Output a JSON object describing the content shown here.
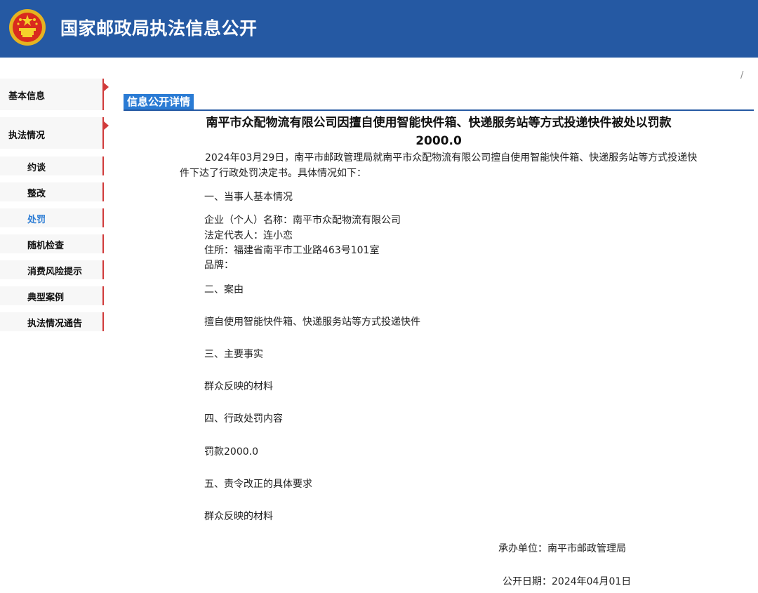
{
  "header": {
    "title": "国家邮政局执法信息公开",
    "emblem_icon": "national-emblem-icon",
    "background": "#2559a3"
  },
  "sidebar": {
    "top_items": [
      {
        "label": "基本信息"
      },
      {
        "label": "执法情况"
      }
    ],
    "sub_items": [
      {
        "label": "约谈"
      },
      {
        "label": "整改"
      },
      {
        "label": "处罚",
        "active": true
      },
      {
        "label": "随机检查"
      },
      {
        "label": "消费风险提示"
      },
      {
        "label": "典型案例"
      },
      {
        "label": "执法情况通告"
      }
    ],
    "accent": "#d13a3a",
    "active_color": "#2a7bd4"
  },
  "breadcrumb": {
    "separator": "/"
  },
  "main": {
    "section_tab": "信息公开详情",
    "title_line1": "南平市众配物流有限公司因擅自使用智能快件箱、快递服务站等方式投递快件被处以罚款",
    "title_line2": "2000.0",
    "intro": "2024年03月29日，南平市邮政管理局就南平市众配物流有限公司擅自使用智能快件箱、快递服务站等方式投递快件下达了行政处罚决定书。具体情况如下：",
    "s1_heading": "一、当事人基本情况",
    "s1_name": "企业（个人）名称：南平市众配物流有限公司",
    "s1_rep": "法定代表人：连小恋",
    "s1_addr": "住所：福建省南平市工业路463号101室",
    "s1_brand": "品牌：",
    "s2_heading": "二、案由",
    "s2_text": "擅自使用智能快件箱、快递服务站等方式投递快件",
    "s3_heading": "三、主要事实",
    "s3_text": "群众反映的材料",
    "s4_heading": "四、行政处罚内容",
    "s4_text": "罚款2000.0",
    "s5_heading": "五、责令改正的具体要求",
    "s5_text": "群众反映的材料",
    "handler": "承办单位：南平市邮政管理局",
    "publish_date": "公开日期：2024年04月01日"
  }
}
